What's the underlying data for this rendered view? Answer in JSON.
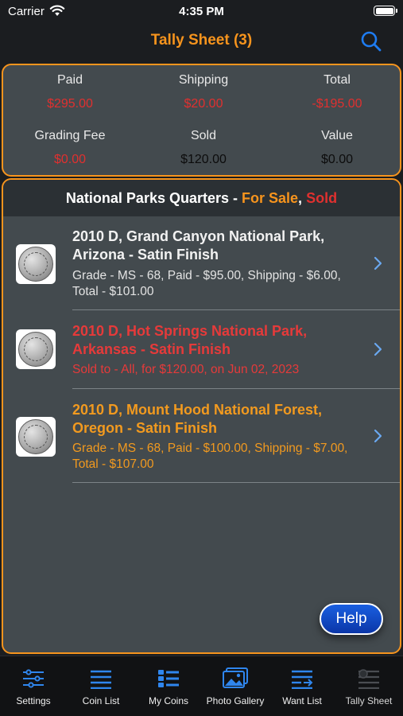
{
  "status_bar": {
    "carrier": "Carrier",
    "time": "4:35 PM"
  },
  "nav": {
    "title": "Tally Sheet (3)"
  },
  "summary": {
    "paid_label": "Paid",
    "paid_value": "$295.00",
    "shipping_label": "Shipping",
    "shipping_value": "$20.00",
    "total_label": "Total",
    "total_value": "-$195.00",
    "grading_label": "Grading Fee",
    "grading_value": "$0.00",
    "sold_label": "Sold",
    "sold_value": "$120.00",
    "value_label": "Value",
    "value_value": "$0.00"
  },
  "section": {
    "title": "National Parks Quarters - ",
    "for_sale": "For Sale",
    "comma": ", ",
    "sold": "Sold"
  },
  "items": [
    {
      "title": "2010 D, Grand Canyon National Park, Arizona - Satin Finish",
      "detail": "Grade - MS - 68, Paid - $95.00, Shipping - $6.00, Total - $101.00"
    },
    {
      "title": "2010 D, Hot Springs National Park, Arkansas - Satin Finish",
      "detail": "Sold to - All, for $120.00, on Jun 02, 2023"
    },
    {
      "title": "2010 D, Mount Hood National Forest, Oregon - Satin Finish",
      "detail": "Grade - MS - 68, Paid - $100.00, Shipping - $7.00, Total - $107.00"
    }
  ],
  "help_button": "Help",
  "tabs": [
    {
      "label": "Settings"
    },
    {
      "label": "Coin List"
    },
    {
      "label": "My Coins"
    },
    {
      "label": "Photo Gallery"
    },
    {
      "label": "Want List"
    },
    {
      "label": "Tally Sheet"
    }
  ],
  "colors": {
    "accent": "#f7941d",
    "loss": "#e0302f",
    "tint": "#1e7cf2"
  },
  "icons": [
    "wifi-icon",
    "battery-icon",
    "search-icon",
    "chevron-right-icon",
    "sliders-icon",
    "list-icon",
    "grid-list-icon",
    "photo-gallery-icon",
    "want-list-icon",
    "tally-sheet-icon"
  ]
}
